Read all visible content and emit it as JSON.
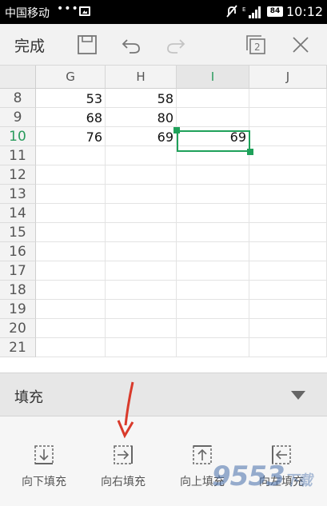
{
  "status_bar": {
    "carrier": "中国移动",
    "dots": "•••",
    "battery": "84",
    "time": "10:12"
  },
  "toolbar": {
    "done_label": "完成",
    "icons": [
      "save-icon",
      "undo-icon",
      "redo-icon",
      "windows-icon",
      "close-icon"
    ],
    "window_count": "2"
  },
  "sheet": {
    "columns": [
      "G",
      "H",
      "I",
      "J"
    ],
    "active_column": "I",
    "active_row": "10",
    "rows": [
      {
        "num": "8",
        "cells": [
          "53",
          "58",
          "",
          ""
        ]
      },
      {
        "num": "9",
        "cells": [
          "68",
          "80",
          "",
          ""
        ]
      },
      {
        "num": "10",
        "cells": [
          "76",
          "69",
          "69",
          ""
        ]
      },
      {
        "num": "11",
        "cells": [
          "",
          "",
          "",
          ""
        ]
      },
      {
        "num": "12",
        "cells": [
          "",
          "",
          "",
          ""
        ]
      },
      {
        "num": "13",
        "cells": [
          "",
          "",
          "",
          ""
        ]
      },
      {
        "num": "14",
        "cells": [
          "",
          "",
          "",
          ""
        ]
      },
      {
        "num": "15",
        "cells": [
          "",
          "",
          "",
          ""
        ]
      },
      {
        "num": "16",
        "cells": [
          "",
          "",
          "",
          ""
        ]
      },
      {
        "num": "17",
        "cells": [
          "",
          "",
          "",
          ""
        ]
      },
      {
        "num": "18",
        "cells": [
          "",
          "",
          "",
          ""
        ]
      },
      {
        "num": "19",
        "cells": [
          "",
          "",
          "",
          ""
        ]
      },
      {
        "num": "20",
        "cells": [
          "",
          "",
          "",
          ""
        ]
      },
      {
        "num": "21",
        "cells": [
          "",
          "",
          "",
          ""
        ]
      }
    ]
  },
  "fill_panel": {
    "title": "填充",
    "buttons": [
      {
        "label": "向下填充",
        "icon": "fill-down-icon"
      },
      {
        "label": "向右填充",
        "icon": "fill-right-icon"
      },
      {
        "label": "向上填充",
        "icon": "fill-up-icon"
      },
      {
        "label": "向左填充",
        "icon": "fill-left-icon"
      }
    ]
  },
  "watermark": {
    "main": "9553",
    "sub": "下载"
  },
  "colors": {
    "accent": "#1fa15a",
    "arrow": "#d93a2b"
  }
}
